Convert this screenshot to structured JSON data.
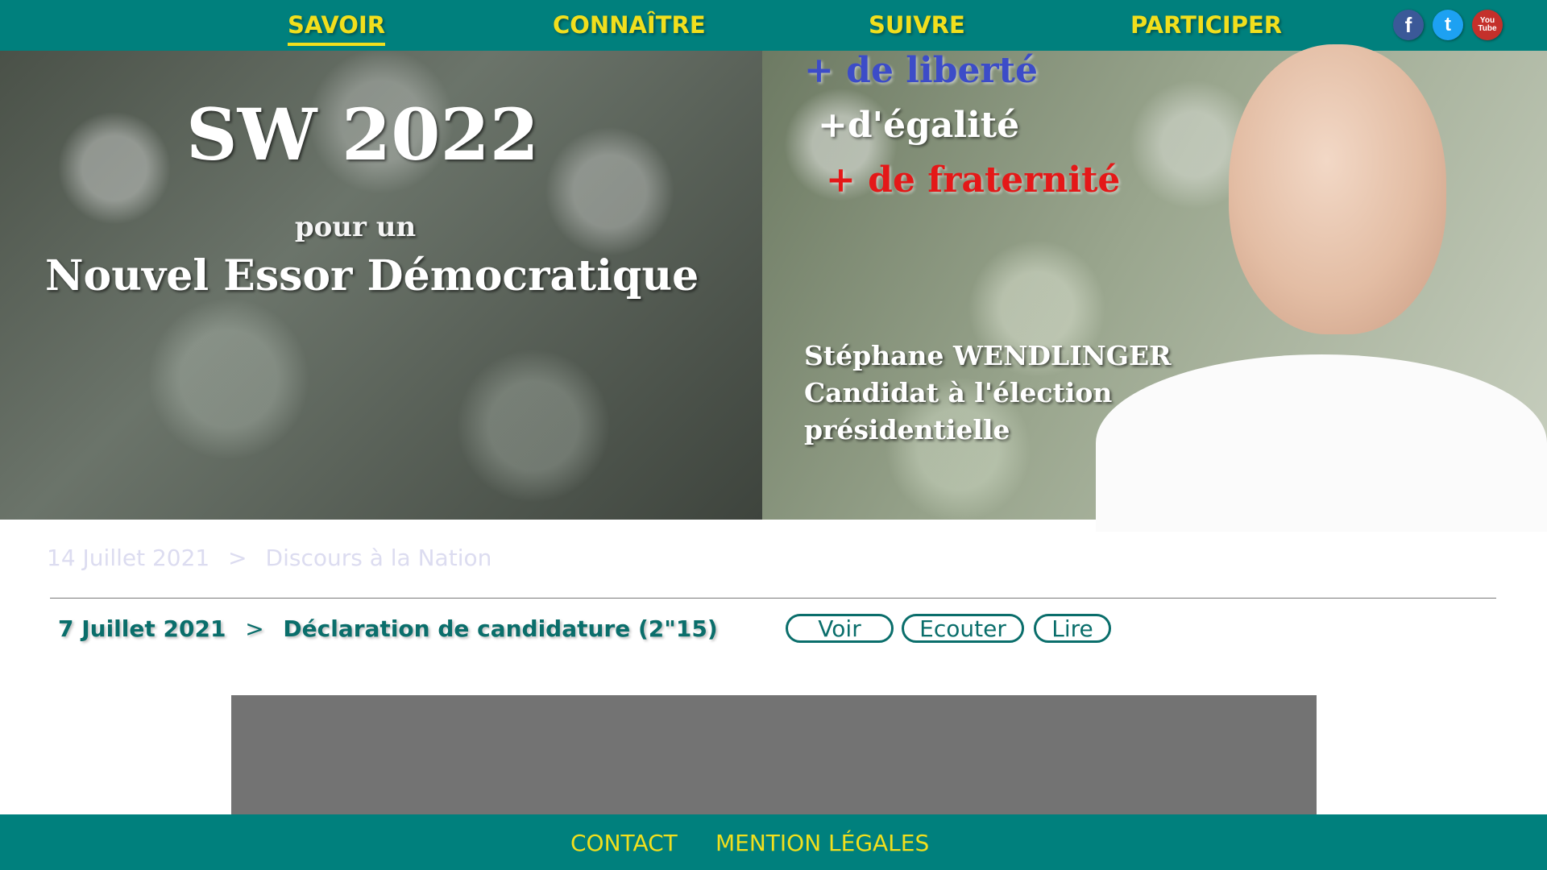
{
  "nav": {
    "items": [
      {
        "label": "SAVOIR",
        "active": true
      },
      {
        "label": "CONNAÎTRE",
        "active": false
      },
      {
        "label": "SUIVRE",
        "active": false
      },
      {
        "label": "PARTICIPER",
        "active": false
      }
    ],
    "social": [
      {
        "icon": "facebook-icon",
        "glyph": "f",
        "color": "#3b5998"
      },
      {
        "icon": "twitter-icon",
        "glyph": "t",
        "color": "#1da1f2"
      },
      {
        "icon": "youtube-icon",
        "glyph": "You Tube",
        "color": "#c4302b"
      }
    ]
  },
  "banner": {
    "title": "SW 2022",
    "pour": "pour un",
    "subtitle": "Nouvel Essor Démocratique",
    "slogans": [
      "+ de liberté",
      "+d'égalité",
      "+ de fraternité"
    ],
    "candidate_name": "Stéphane WENDLINGER",
    "candidate_line2": "Candidat à l'élection",
    "candidate_line3": "présidentielle"
  },
  "entries": {
    "faded": {
      "date": "14 Juillet 2021",
      "separator": ">",
      "title": "Discours à la Nation"
    },
    "current": {
      "date": "7 Juillet 2021",
      "separator": ">",
      "title": "Déclaration de candidature (2\"15)"
    },
    "buttons": {
      "watch": "Voir",
      "listen": "Ecouter",
      "read": "Lire"
    }
  },
  "footer": {
    "contact": "CONTACT",
    "legal": "MENTION LÉGALES"
  },
  "colors": {
    "header_bg": "#00807d",
    "accent_yellow": "#f1df1d",
    "teal_text": "#0a6e6b",
    "video_placeholder": "#737373"
  }
}
